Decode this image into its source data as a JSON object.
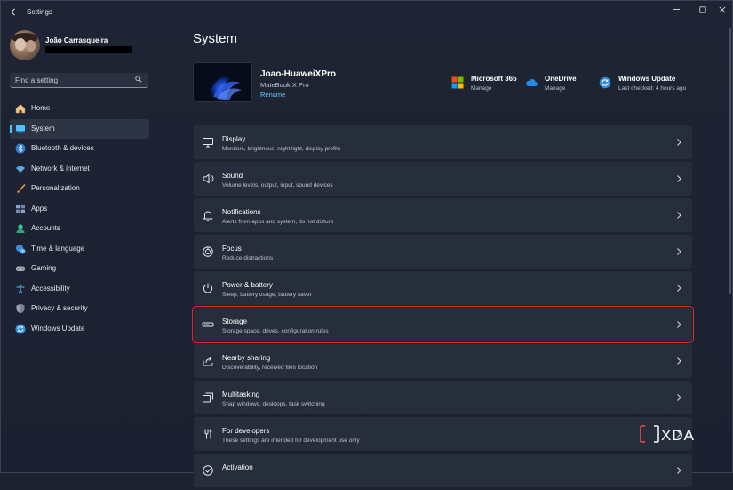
{
  "app": {
    "title": "Settings"
  },
  "user": {
    "name": "João Carrasqueira"
  },
  "search": {
    "placeholder": "Find a setting"
  },
  "sidebar": {
    "items": [
      {
        "label": "Home",
        "icon": "home-icon"
      },
      {
        "label": "System",
        "icon": "system-icon",
        "active": true
      },
      {
        "label": "Bluetooth & devices",
        "icon": "bluetooth-icon"
      },
      {
        "label": "Network & internet",
        "icon": "wifi-icon"
      },
      {
        "label": "Personalization",
        "icon": "brush-icon"
      },
      {
        "label": "Apps",
        "icon": "apps-icon"
      },
      {
        "label": "Accounts",
        "icon": "accounts-icon"
      },
      {
        "label": "Time & language",
        "icon": "globe-clock-icon"
      },
      {
        "label": "Gaming",
        "icon": "gamepad-icon"
      },
      {
        "label": "Accessibility",
        "icon": "accessibility-icon"
      },
      {
        "label": "Privacy & security",
        "icon": "shield-icon"
      },
      {
        "label": "Windows Update",
        "icon": "windows-update-icon"
      }
    ]
  },
  "main": {
    "title": "System",
    "device": {
      "name": "Joao-HuaweiXPro",
      "model": "MateBook X Pro",
      "rename": "Rename"
    },
    "quick": [
      {
        "title": "Microsoft 365",
        "sub": "Manage",
        "icon": "microsoft-365-icon"
      },
      {
        "title": "OneDrive",
        "sub": "Manage",
        "icon": "onedrive-icon"
      },
      {
        "title": "Windows Update",
        "sub": "Last checked: 4 hours ago",
        "icon": "windows-update-icon"
      }
    ],
    "settings": [
      {
        "title": "Display",
        "sub": "Monitors, brightness, night light, display profile",
        "icon": "display-icon"
      },
      {
        "title": "Sound",
        "sub": "Volume levels, output, input, sound devices",
        "icon": "speaker-icon"
      },
      {
        "title": "Notifications",
        "sub": "Alerts from apps and system, do not disturb",
        "icon": "bell-icon"
      },
      {
        "title": "Focus",
        "sub": "Reduce distractions",
        "icon": "focus-icon"
      },
      {
        "title": "Power & battery",
        "sub": "Sleep, battery usage, battery saver",
        "icon": "power-icon"
      },
      {
        "title": "Storage",
        "sub": "Storage space, drives, configuration rules",
        "icon": "storage-icon",
        "highlighted": true
      },
      {
        "title": "Nearby sharing",
        "sub": "Discoverability, received files location",
        "icon": "share-icon"
      },
      {
        "title": "Multitasking",
        "sub": "Snap windows, desktops, task switching",
        "icon": "multitasking-icon"
      },
      {
        "title": "For developers",
        "sub": "These settings are intended for development use only",
        "icon": "developer-tools-icon"
      },
      {
        "title": "Activation",
        "sub": "",
        "icon": "activation-icon"
      }
    ]
  },
  "watermark": {
    "text": "XDA"
  },
  "colors": {
    "accent": "#4cc2ff",
    "link": "#60cdff",
    "highlight": "#e02b2b",
    "background": "#1c2230",
    "card": "#262d3b"
  }
}
